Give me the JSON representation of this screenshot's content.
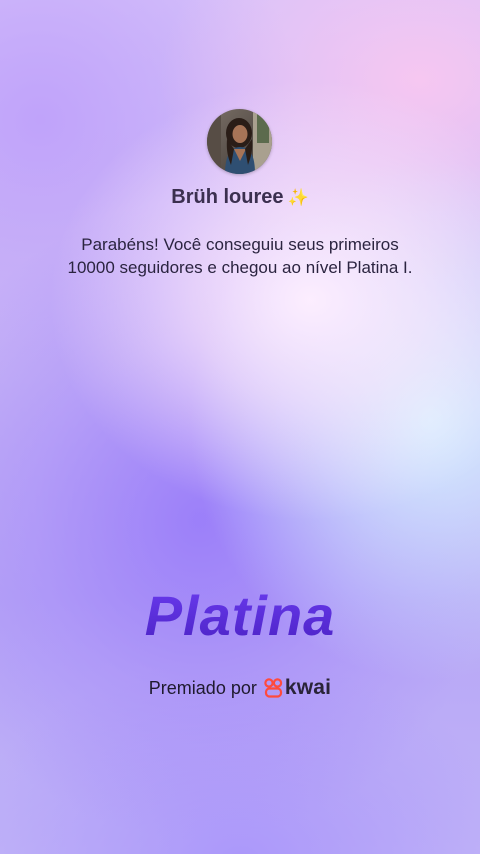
{
  "profile": {
    "username": "Brüh louree",
    "sparkle_icon": "sparkles-icon"
  },
  "achievement": {
    "message": "Parabéns! Você conseguiu seus primeiros 10000 seguidores e chegou ao nível Platina I.",
    "tier": "Platina"
  },
  "footer": {
    "awarded_by": "Premiado por",
    "brand": "kwai",
    "brand_icon": "kwai-logo-icon"
  },
  "colors": {
    "tier_text": "#5a2fd6",
    "brand_accent": "#ff4a3d",
    "text_dark": "#2b2440"
  }
}
